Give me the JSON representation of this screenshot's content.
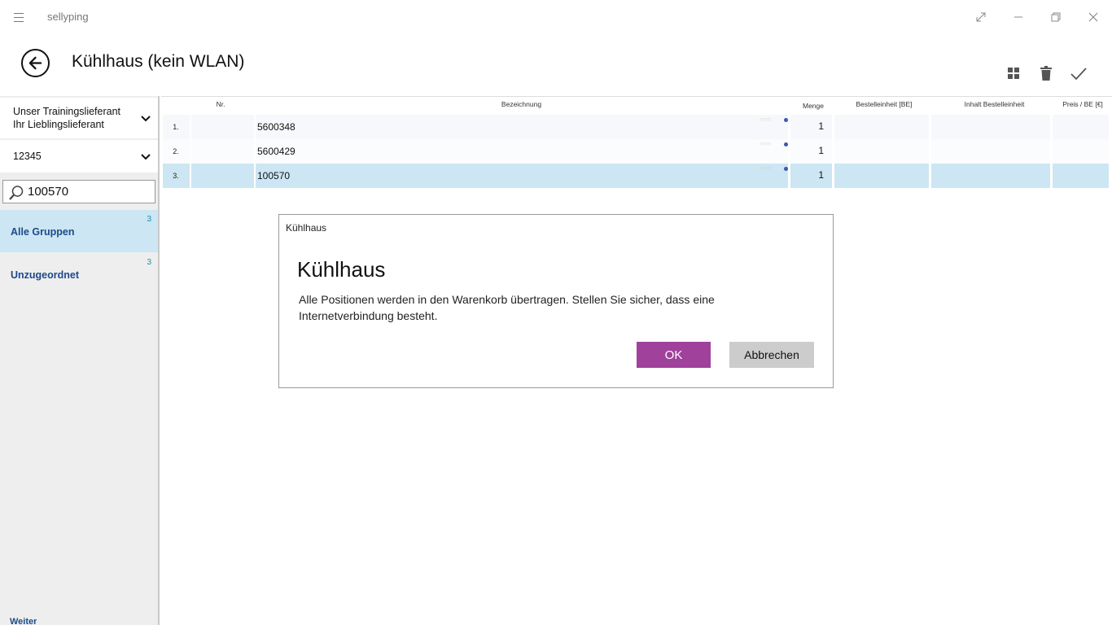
{
  "app": {
    "title": "sellyping"
  },
  "header": {
    "title": "Kühlhaus (kein WLAN)"
  },
  "sidebar": {
    "supplier_line1": "Unser Trainingslieferant",
    "supplier_line2": "Ihr Lieblingslieferant",
    "account": "12345",
    "search_value": "100570",
    "groups": [
      {
        "name": "Alle Gruppen",
        "count": "3",
        "selected": true
      },
      {
        "name": "Unzugeordnet",
        "count": "3",
        "selected": false
      }
    ],
    "cut_text": "Weiter"
  },
  "table": {
    "columns": [
      "Nr.",
      "Bezeichnung",
      "Menge",
      "Bestelleinheit [BE]",
      "Inhalt Bestelleinheit",
      "Preis / BE [€]"
    ],
    "rows": [
      {
        "index": "1.",
        "nr": "",
        "bezeichnung": "5600348",
        "menge": "1",
        "be": "",
        "inhalt": "",
        "preis": "",
        "selected": false
      },
      {
        "index": "2.",
        "nr": "",
        "bezeichnung": "5600429",
        "menge": "1",
        "be": "",
        "inhalt": "",
        "preis": "",
        "selected": false
      },
      {
        "index": "3.",
        "nr": "",
        "bezeichnung": "100570",
        "menge": "1",
        "be": "",
        "inhalt": "",
        "preis": "",
        "selected": true
      }
    ]
  },
  "dialog": {
    "caption": "Kühlhaus",
    "title": "Kühlhaus",
    "message": "Alle Positionen werden in den Warenkorb übertragen. Stellen Sie sicher, dass eine Internetverbindung besteht.",
    "ok_label": "OK",
    "cancel_label": "Abbrechen"
  },
  "colors": {
    "accent": "#a0419b",
    "selection": "#cce6f3",
    "link": "#1c4a8a"
  }
}
